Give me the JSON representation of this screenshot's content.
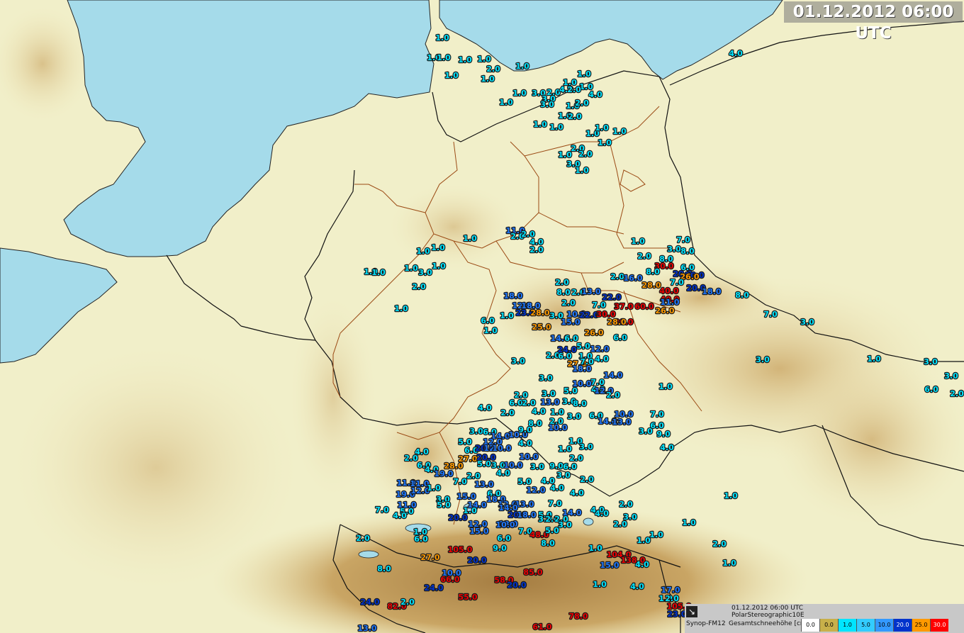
{
  "header": {
    "timestamp": "01.12.2012 06:00 UTC"
  },
  "footer": {
    "time": "01.12.2012 06:00 UTC",
    "projection": "PolarStereographic10E",
    "product": "Synop-FM12",
    "parameter": "Gesamtschneehöhe [cm] [cm]",
    "arrow_icon": "arrow-icon",
    "legend": [
      {
        "label": "0.0",
        "color": "#ffffff",
        "text": "#000"
      },
      {
        "label": "0.0",
        "color": "#c8b04a",
        "text": "#000"
      },
      {
        "label": "1.0",
        "color": "#00e5ff",
        "text": "#000"
      },
      {
        "label": "5.0",
        "color": "#33ccff",
        "text": "#000"
      },
      {
        "label": "10.0",
        "color": "#3399ff",
        "text": "#000"
      },
      {
        "label": "20.0",
        "color": "#0033cc",
        "text": "#fff"
      },
      {
        "label": "25.0",
        "color": "#ff9900",
        "text": "#000"
      },
      {
        "label": "30.0",
        "color": "#ff0000",
        "text": "#fff"
      }
    ]
  },
  "colors": {
    "sea": "#a5dbea",
    "land": "#f1efc9",
    "relief": "#c9a060",
    "cyan": "#00e5ff",
    "blue": "#1e78ff",
    "navy": "#0033cc",
    "orange": "#ff9900",
    "red": "#ee0000"
  },
  "stations": [
    [
      "1.0",
      624,
      54
    ],
    [
      "1.0",
      612,
      82
    ],
    [
      "1.0",
      626,
      82
    ],
    [
      "1.0",
      656,
      85
    ],
    [
      "1.0",
      683,
      84
    ],
    [
      "2.0",
      696,
      98
    ],
    [
      "1.0",
      637,
      107
    ],
    [
      "1.0",
      688,
      112
    ],
    [
      "1.0",
      737,
      94
    ],
    [
      "1.0",
      824,
      105
    ],
    [
      "1.0",
      804,
      117
    ],
    [
      "1.0",
      827,
      123
    ],
    [
      "3.0",
      760,
      132
    ],
    [
      "1.0",
      733,
      132
    ],
    [
      "2.0",
      781,
      131
    ],
    [
      "4.0",
      799,
      127
    ],
    [
      "2.0",
      810,
      127
    ],
    [
      "4.0",
      840,
      134
    ],
    [
      "3.0",
      774,
      140
    ],
    [
      "3.0",
      772,
      148
    ],
    [
      "1.0",
      714,
      145
    ],
    [
      "1.0",
      808,
      150
    ],
    [
      "2.0",
      821,
      146
    ],
    [
      "1.0",
      797,
      164
    ],
    [
      "2.0",
      811,
      165
    ],
    [
      "1.0",
      762,
      176
    ],
    [
      "1.0",
      785,
      180
    ],
    [
      "1.0",
      836,
      189
    ],
    [
      "1.0",
      849,
      181
    ],
    [
      "1.0",
      874,
      186
    ],
    [
      "1.0",
      853,
      202
    ],
    [
      "2.0",
      815,
      210
    ],
    [
      "1.0",
      797,
      219
    ],
    [
      "2.0",
      826,
      218
    ],
    [
      "3.0",
      809,
      232
    ],
    [
      "1.0",
      821,
      241
    ],
    [
      "4.0",
      1038,
      76
    ],
    [
      "11.0",
      727,
      326
    ],
    [
      "2.0",
      730,
      334
    ],
    [
      "2.0",
      745,
      331
    ],
    [
      "4.0",
      757,
      342
    ],
    [
      "2.0",
      757,
      353
    ],
    [
      "1.0",
      663,
      337
    ],
    [
      "1.0",
      597,
      355
    ],
    [
      "1.0",
      618,
      350
    ],
    [
      "1.0",
      523,
      384
    ],
    [
      "1.0",
      534,
      385
    ],
    [
      "1.0",
      580,
      379
    ],
    [
      "3.0",
      600,
      385
    ],
    [
      "1.0",
      619,
      376
    ],
    [
      "2.0",
      591,
      405
    ],
    [
      "1.0",
      566,
      436
    ],
    [
      "1.0",
      900,
      341
    ],
    [
      "7.0",
      964,
      339
    ],
    [
      "3.0",
      951,
      352
    ],
    [
      "8.0",
      970,
      355
    ],
    [
      "2.0",
      909,
      362
    ],
    [
      "8.0",
      940,
      366
    ],
    [
      "30.0",
      937,
      376
    ],
    [
      "6.0",
      970,
      378
    ],
    [
      "20.0",
      963,
      387
    ],
    [
      "20.0",
      980,
      389
    ],
    [
      "26.0",
      973,
      391
    ],
    [
      "2.0",
      871,
      391
    ],
    [
      "16.0",
      893,
      393
    ],
    [
      "8.0",
      921,
      384
    ],
    [
      "28.0",
      919,
      403
    ],
    [
      "7.0",
      955,
      399
    ],
    [
      "20.0",
      982,
      407
    ],
    [
      "18.0",
      1004,
      412
    ],
    [
      "8.0",
      1047,
      417
    ],
    [
      "40.0",
      944,
      411
    ],
    [
      "40.0",
      945,
      423
    ],
    [
      "11.0",
      945,
      427
    ],
    [
      "26.0",
      938,
      439
    ],
    [
      "2.0",
      793,
      399
    ],
    [
      "18.0",
      724,
      418
    ],
    [
      "8.0",
      795,
      413
    ],
    [
      "2.0",
      816,
      413
    ],
    [
      "13.0",
      834,
      412
    ],
    [
      "22.0",
      863,
      420
    ],
    [
      "2.0",
      802,
      428
    ],
    [
      "7.0",
      845,
      431
    ],
    [
      "12.0",
      736,
      432
    ],
    [
      "18.0",
      749,
      432
    ],
    [
      "23.0",
      741,
      442
    ],
    [
      "28.0",
      762,
      442
    ],
    [
      "3.0",
      785,
      446
    ],
    [
      "10.0",
      813,
      444
    ],
    [
      "22.0",
      831,
      445
    ],
    [
      "1.0",
      715,
      446
    ],
    [
      "30.0",
      855,
      444
    ],
    [
      "37.0",
      880,
      433
    ],
    [
      "60.0",
      909,
      433
    ],
    [
      "15.0",
      805,
      455
    ],
    [
      "30.0",
      880,
      455
    ],
    [
      "28.0",
      870,
      455
    ],
    [
      "6.0",
      688,
      453
    ],
    [
      "1.0",
      692,
      467
    ],
    [
      "25.0",
      764,
      462
    ],
    [
      "26.0",
      838,
      470
    ],
    [
      "6.0",
      875,
      477
    ],
    [
      "14.0",
      790,
      478
    ],
    [
      "6.0",
      806,
      478
    ],
    [
      "5.0",
      823,
      489
    ],
    [
      "24.0",
      800,
      494
    ],
    [
      "12.0",
      846,
      493
    ],
    [
      "2.0",
      780,
      502
    ],
    [
      "6.0",
      797,
      503
    ],
    [
      "1.0",
      826,
      503
    ],
    [
      "4.0",
      849,
      507
    ],
    [
      "27.0",
      814,
      514
    ],
    [
      "7.0",
      828,
      511
    ],
    [
      "18.0",
      821,
      521
    ],
    [
      "7.0",
      1087,
      444
    ],
    [
      "3.0",
      1139,
      455
    ],
    [
      "3.0",
      1076,
      508
    ],
    [
      "1.0",
      1233,
      507
    ],
    [
      "3.0",
      1313,
      511
    ],
    [
      "3.0",
      1342,
      531
    ],
    [
      "6.0",
      1314,
      550
    ],
    [
      "2.0",
      1350,
      556
    ],
    [
      "3.0",
      731,
      510
    ],
    [
      "3.0",
      770,
      534
    ],
    [
      "14.0",
      865,
      530
    ],
    [
      "7.0",
      843,
      540
    ],
    [
      "10.0",
      821,
      542
    ],
    [
      "4.0",
      844,
      550
    ],
    [
      "12.0",
      852,
      552
    ],
    [
      "2.0",
      865,
      558
    ],
    [
      "1.0",
      939,
      546
    ],
    [
      "2.0",
      735,
      558
    ],
    [
      "3.0",
      774,
      556
    ],
    [
      "5.0",
      805,
      552
    ],
    [
      "3.0",
      803,
      567
    ],
    [
      "8.0",
      818,
      570
    ],
    [
      "6.0",
      728,
      569
    ],
    [
      "2.0",
      746,
      569
    ],
    [
      "13.0",
      776,
      568
    ],
    [
      "4.0",
      684,
      576
    ],
    [
      "2.0",
      716,
      583
    ],
    [
      "4.0",
      760,
      581
    ],
    [
      "1.0",
      786,
      582
    ],
    [
      "6.0",
      841,
      587
    ],
    [
      "10.0",
      880,
      585
    ],
    [
      "7.0",
      927,
      585
    ],
    [
      "8.0",
      755,
      598
    ],
    [
      "2.0",
      785,
      595
    ],
    [
      "10.0",
      787,
      604
    ],
    [
      "3.0",
      810,
      588
    ],
    [
      "14.0",
      857,
      595
    ],
    [
      "13.0",
      877,
      596
    ],
    [
      "3.0",
      911,
      609
    ],
    [
      "6.0",
      927,
      601
    ],
    [
      "9.0",
      936,
      613
    ],
    [
      "4.0",
      941,
      632
    ],
    [
      "3.0",
      672,
      609
    ],
    [
      "6.0",
      691,
      610
    ],
    [
      "14.0",
      706,
      616
    ],
    [
      "10.0",
      731,
      614
    ],
    [
      "9.0",
      741,
      607
    ],
    [
      "5.0",
      656,
      624
    ],
    [
      "12.0",
      695,
      624
    ],
    [
      "4.0",
      741,
      626
    ],
    [
      "6.0",
      665,
      636
    ],
    [
      "20.0",
      684,
      633
    ],
    [
      "12.0",
      696,
      633
    ],
    [
      "10.0",
      708,
      633
    ],
    [
      "1.0",
      797,
      634
    ],
    [
      "1.0",
      812,
      623
    ],
    [
      "3.0",
      827,
      631
    ],
    [
      "4.0",
      595,
      638
    ],
    [
      "2.0",
      580,
      647
    ],
    [
      "6.0",
      598,
      657
    ],
    [
      "28.0",
      640,
      658
    ],
    [
      "27.0",
      660,
      648
    ],
    [
      "20.0",
      686,
      646
    ],
    [
      "5.0",
      683,
      655
    ],
    [
      "3.0",
      703,
      657
    ],
    [
      "10.0",
      724,
      657
    ],
    [
      "10.0",
      746,
      645
    ],
    [
      "3.0",
      758,
      659
    ],
    [
      "9.0",
      785,
      658
    ],
    [
      "6.0",
      804,
      659
    ],
    [
      "2.0",
      813,
      647
    ],
    [
      "4.0",
      609,
      663
    ],
    [
      "19.0",
      626,
      669
    ],
    [
      "7.0",
      649,
      680
    ],
    [
      "2.0",
      668,
      672
    ],
    [
      "4.0",
      710,
      668
    ],
    [
      "5.0",
      740,
      680
    ],
    [
      "4.0",
      773,
      679
    ],
    [
      "3.0",
      795,
      671
    ],
    [
      "2.0",
      828,
      677
    ],
    [
      "11.0",
      573,
      682
    ],
    [
      "11.0",
      592,
      683
    ],
    [
      "13.0",
      683,
      684
    ],
    [
      "4.0",
      786,
      689
    ],
    [
      "6.0",
      697,
      697
    ],
    [
      "19.0",
      572,
      698
    ],
    [
      "12.0",
      593,
      693
    ],
    [
      "1.0",
      612,
      689
    ],
    [
      "15.0",
      658,
      701
    ],
    [
      "3.0",
      625,
      705
    ],
    [
      "18.0",
      700,
      705
    ],
    [
      "12.0",
      756,
      692
    ],
    [
      "4.0",
      814,
      696
    ],
    [
      "5.0",
      626,
      713
    ],
    [
      "14.0",
      673,
      713
    ],
    [
      "12.0",
      716,
      712
    ],
    [
      "13.0",
      740,
      712
    ],
    [
      "7.0",
      783,
      711
    ],
    [
      "2.0",
      883,
      712
    ],
    [
      "7.0",
      539,
      720
    ],
    [
      "11.0",
      574,
      713
    ],
    [
      "5.0",
      574,
      722
    ],
    [
      "1.0",
      663,
      721
    ],
    [
      "14.0",
      717,
      717
    ],
    [
      "20.0",
      730,
      727
    ],
    [
      "18.0",
      743,
      727
    ],
    [
      "5.0",
      769,
      727
    ],
    [
      "14.0",
      807,
      724
    ],
    [
      "4.0",
      843,
      720
    ],
    [
      "4.0",
      849,
      725
    ],
    [
      "4.0",
      564,
      728
    ],
    [
      "20.0",
      646,
      731
    ],
    [
      "12.0",
      674,
      740
    ],
    [
      "13.0",
      717,
      740
    ],
    [
      "3.0",
      769,
      733
    ],
    [
      "2.0",
      779,
      733
    ],
    [
      "2.0",
      792,
      733
    ],
    [
      "3.0",
      797,
      741
    ],
    [
      "3.0",
      889,
      730
    ],
    [
      "2.0",
      875,
      740
    ],
    [
      "1.0",
      1031,
      700
    ],
    [
      "15.0",
      676,
      750
    ],
    [
      "10.0",
      713,
      741
    ],
    [
      "7.0",
      741,
      750
    ],
    [
      "48.0",
      761,
      755
    ],
    [
      "5.0",
      779,
      749
    ],
    [
      "1.0",
      972,
      738
    ],
    [
      "1.0",
      593,
      751
    ],
    [
      "6.0",
      594,
      761
    ],
    [
      "2.0",
      512,
      760
    ],
    [
      "6.0",
      711,
      760
    ],
    [
      "8.0",
      773,
      767
    ],
    [
      "1.0",
      926,
      755
    ],
    [
      "1.0",
      908,
      763
    ],
    [
      "2.0",
      1015,
      768
    ],
    [
      "9.0",
      705,
      774
    ],
    [
      "1.0",
      840,
      774
    ],
    [
      "104.0",
      873,
      783
    ],
    [
      "138.0",
      893,
      791
    ],
    [
      "105.0",
      649,
      776
    ],
    [
      "27.0",
      607,
      787
    ],
    [
      "20.0",
      673,
      791
    ],
    [
      "4.0",
      906,
      797
    ],
    [
      "1.0",
      1029,
      795
    ],
    [
      "15.0",
      860,
      798
    ],
    [
      "8.0",
      542,
      803
    ],
    [
      "10.0",
      637,
      809
    ],
    [
      "66.0",
      635,
      818
    ],
    [
      "85.0",
      752,
      808
    ],
    [
      "58.0",
      711,
      819
    ],
    [
      "20.0",
      729,
      826
    ],
    [
      "24.0",
      612,
      830
    ],
    [
      "1.0",
      846,
      825
    ],
    [
      "4.0",
      899,
      828
    ],
    [
      "17.0",
      946,
      833
    ],
    [
      "1.0",
      939,
      845
    ],
    [
      "2.0",
      948,
      845
    ],
    [
      "55.0",
      660,
      843
    ],
    [
      "24.0",
      522,
      850
    ],
    [
      "82.0",
      560,
      856
    ],
    [
      "2.0",
      575,
      850
    ],
    [
      "105.0",
      958,
      856
    ],
    [
      "23.0",
      955,
      867
    ],
    [
      "78.0",
      816,
      870
    ],
    [
      "13.0",
      518,
      887
    ],
    [
      "61.0",
      765,
      885
    ]
  ]
}
